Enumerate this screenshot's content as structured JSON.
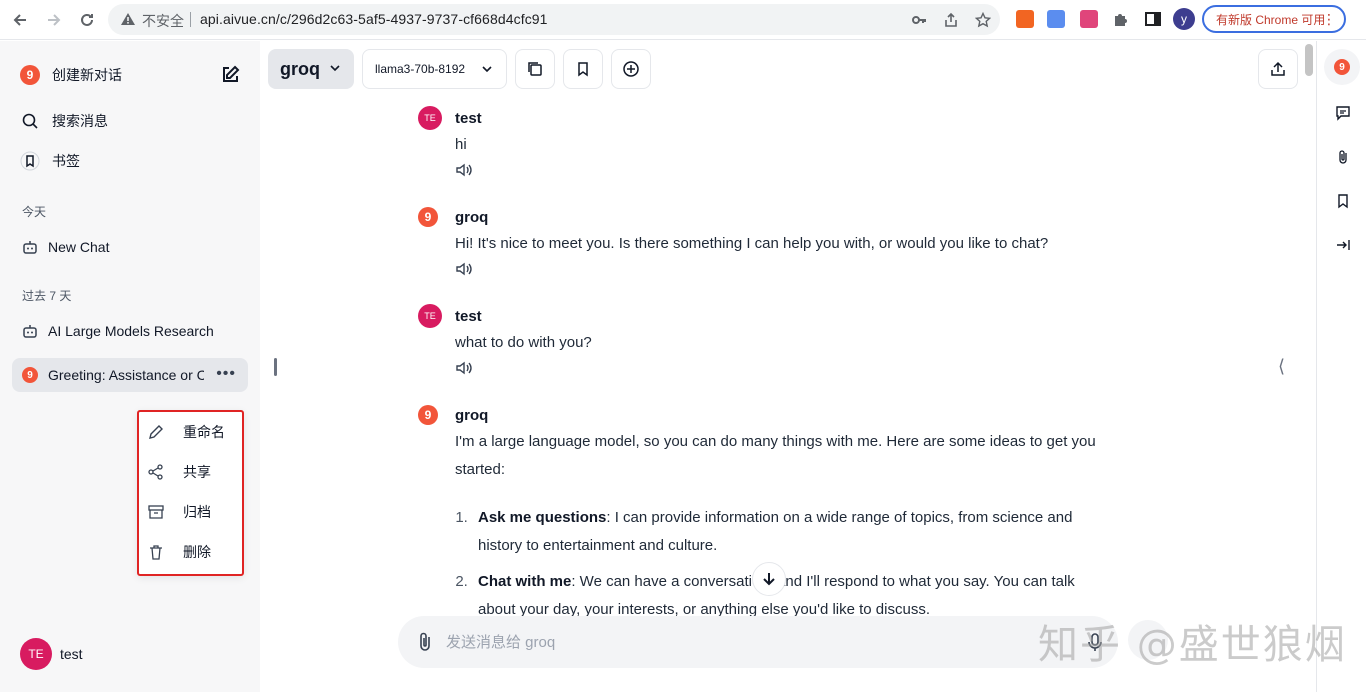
{
  "browser": {
    "insecure_label": "不安全",
    "url": "api.aivue.cn/c/296d2c63-5af5-4937-9737-cf668d4cfc91",
    "profile_initial": "y",
    "update_label": "有新版 Chrome 可用"
  },
  "sidebar": {
    "new_chat_label": "创建新对话",
    "search_label": "搜索消息",
    "bookmarks_label": "书签",
    "section_today": "今天",
    "section_past7": "过去 7 天",
    "chats_today": [
      {
        "label": "New Chat"
      }
    ],
    "chats_past7": [
      {
        "label": "AI Large Models Research"
      },
      {
        "label": "Greeting: Assistance or Chat?"
      }
    ],
    "context_menu": [
      {
        "label": "重命名",
        "icon": "pencil-icon"
      },
      {
        "label": "共享",
        "icon": "share-icon"
      },
      {
        "label": "归档",
        "icon": "archive-icon"
      },
      {
        "label": "删除",
        "icon": "trash-icon"
      }
    ],
    "user": {
      "initials": "TE",
      "name": "test"
    }
  },
  "toolbar": {
    "endpoint": "groq",
    "model": "llama3-70b-8192"
  },
  "messages": [
    {
      "sender": "test",
      "initials": "TE",
      "text": "hi"
    },
    {
      "sender": "groq",
      "logo": "9",
      "text": "Hi! It's nice to meet you. Is there something I can help you with, or would you like to chat?"
    },
    {
      "sender": "test",
      "initials": "TE",
      "text": "what to do with you?"
    },
    {
      "sender": "groq",
      "logo": "9",
      "text": "I'm a large language model, so you can do many things with me. Here are some ideas to get you started:",
      "list": [
        {
          "title": "Ask me questions",
          "text": ": I can provide information on a wide range of topics, from science and history to entertainment and culture."
        },
        {
          "title": "Chat with me",
          "text": ": We can have a conversation, and I'll respond to what you say. You can talk about your day, your interests, or anything else you'd like to discuss."
        }
      ]
    }
  ],
  "composer": {
    "placeholder": "发送消息给 groq"
  },
  "watermark": "知乎 @盛世狼烟",
  "colors": {
    "accent_red": "#e02424",
    "groq_logo": "#f2553a",
    "user_avatar": "#d81b60",
    "update_border": "#3b6ee0"
  }
}
